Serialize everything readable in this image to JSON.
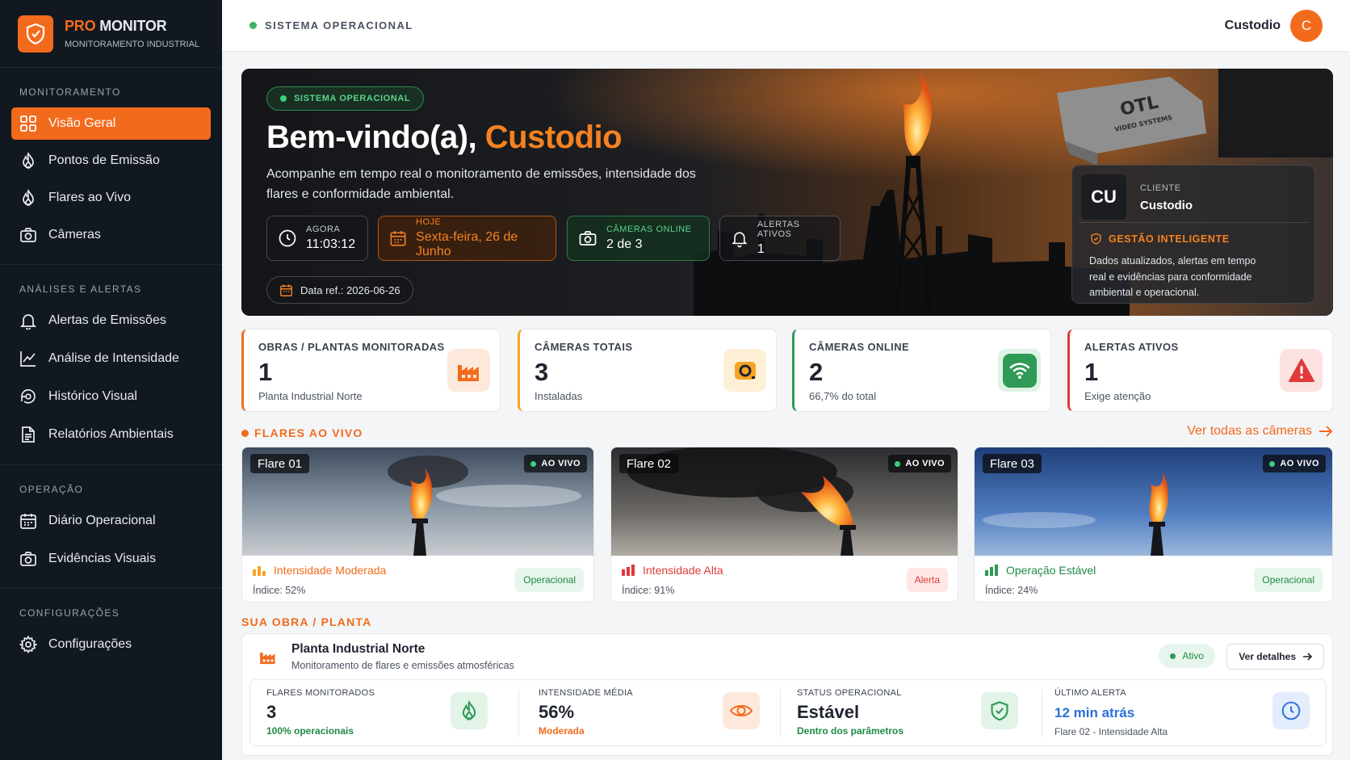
{
  "app": {
    "brand_pre": "PRO",
    "brand_post": " MONITOR",
    "subtitle": "MONITORAMENTO INDUSTRIAL"
  },
  "sidebar": {
    "sections": [
      {
        "title": "MONITORAMENTO",
        "items": [
          "Visão Geral",
          "Pontos de Emissão",
          "Flares ao Vivo",
          "Câmeras"
        ]
      },
      {
        "title": "ANÁLISES E ALERTAS",
        "items": [
          "Alertas de Emissões",
          "Análise de Intensidade",
          "Histórico Visual",
          "Relatórios Ambientais"
        ]
      },
      {
        "title": "OPERAÇÃO",
        "items": [
          "Diário Operacional",
          "Evidências Visuais"
        ]
      },
      {
        "title": "CONFIGURAÇÕES",
        "items": [
          "Configurações"
        ]
      }
    ],
    "active": "Visão Geral"
  },
  "topbar": {
    "status": "SISTEMA OPERACIONAL",
    "user": "Custodio",
    "avatar": "C"
  },
  "hero": {
    "badge": "SISTEMA OPERACIONAL",
    "greeting": "Bem-vindo(a), ",
    "name": "Custodio",
    "description": "Acompanhe em tempo real o monitoramento de emissões, intensidade dos flares e conformidade ambiental.",
    "chips": {
      "now": {
        "label": "AGORA",
        "value": "11:03:12"
      },
      "today": {
        "label": "HOJE",
        "value": "Sexta-feira, 26 de Junho"
      },
      "cameras": {
        "label": "CÂMERAS ONLINE",
        "value": "2 de 3"
      },
      "alerts": {
        "label": "ALERTAS ATIVOS",
        "value": "1"
      }
    },
    "date_ref": "Data ref.: 2026-06-26",
    "camera_brand": "OTL",
    "camera_brand_sub": "VIDEO SYSTEMS",
    "client": {
      "initials": "CU",
      "label": "CLIENTE",
      "name": "Custodio",
      "gestao_title": "GESTÃO INTELIGENTE",
      "gestao_text": "Dados atualizados, alertas em tempo real e evidências para conformidade ambiental e operacional."
    }
  },
  "stats": [
    {
      "label": "OBRAS / PLANTAS MONITORADAS",
      "value": "1",
      "sub": "Planta Industrial Norte",
      "color": "#f26b1d"
    },
    {
      "label": "CÂMERAS TOTAIS",
      "value": "3",
      "sub": "Instaladas",
      "color": "#f5a524"
    },
    {
      "label": "CÂMERAS ONLINE",
      "value": "2",
      "sub": "66,7% do total",
      "color": "#2e9a55"
    },
    {
      "label": "ALERTAS ATIVOS",
      "value": "1",
      "sub": "Exige atenção",
      "color": "#e03a3a"
    }
  ],
  "flares_section": {
    "title": "FLARES AO VIVO",
    "view_all": "Ver todas as câmeras"
  },
  "flares": [
    {
      "title": "Flare 01",
      "live": "AO VIVO",
      "intensity": "Intensidade Moderada",
      "index": "Índice: 52%",
      "badge": "Operacional",
      "index_value": 52
    },
    {
      "title": "Flare 02",
      "live": "AO VIVO",
      "intensity": "Intensidade Alta",
      "index": "Índice: 91%",
      "badge": "Alerta",
      "index_value": 91
    },
    {
      "title": "Flare 03",
      "live": "AO VIVO",
      "intensity": "Operação Estável",
      "index": "Índice: 24%",
      "badge": "Operacional",
      "index_value": 24
    }
  ],
  "plant_section": {
    "title": "SUA OBRA / PLANTA"
  },
  "plant": {
    "name": "Planta Industrial Norte",
    "description": "Monitoramento de flares e emissões atmosféricas",
    "status": "Ativo",
    "details_button": "Ver detalhes",
    "metrics": [
      {
        "label": "FLARES MONITORADOS",
        "value": "3",
        "sub": "100% operacionais"
      },
      {
        "label": "INTENSIDADE MÉDIA",
        "value": "56%",
        "sub": "Moderada"
      },
      {
        "label": "STATUS OPERACIONAL",
        "value": "Estável",
        "sub": "Dentro dos parâmetros"
      },
      {
        "label": "ÚLTIMO ALERTA",
        "value": "12 min atrás",
        "sub": "Flare 02 - Intensidade Alta"
      }
    ]
  },
  "colors": {
    "accent": "#f26b1d",
    "sidebar_bg": "#121820",
    "success": "#2e9a55",
    "danger": "#e03a3a",
    "info": "#2a6fdb"
  }
}
